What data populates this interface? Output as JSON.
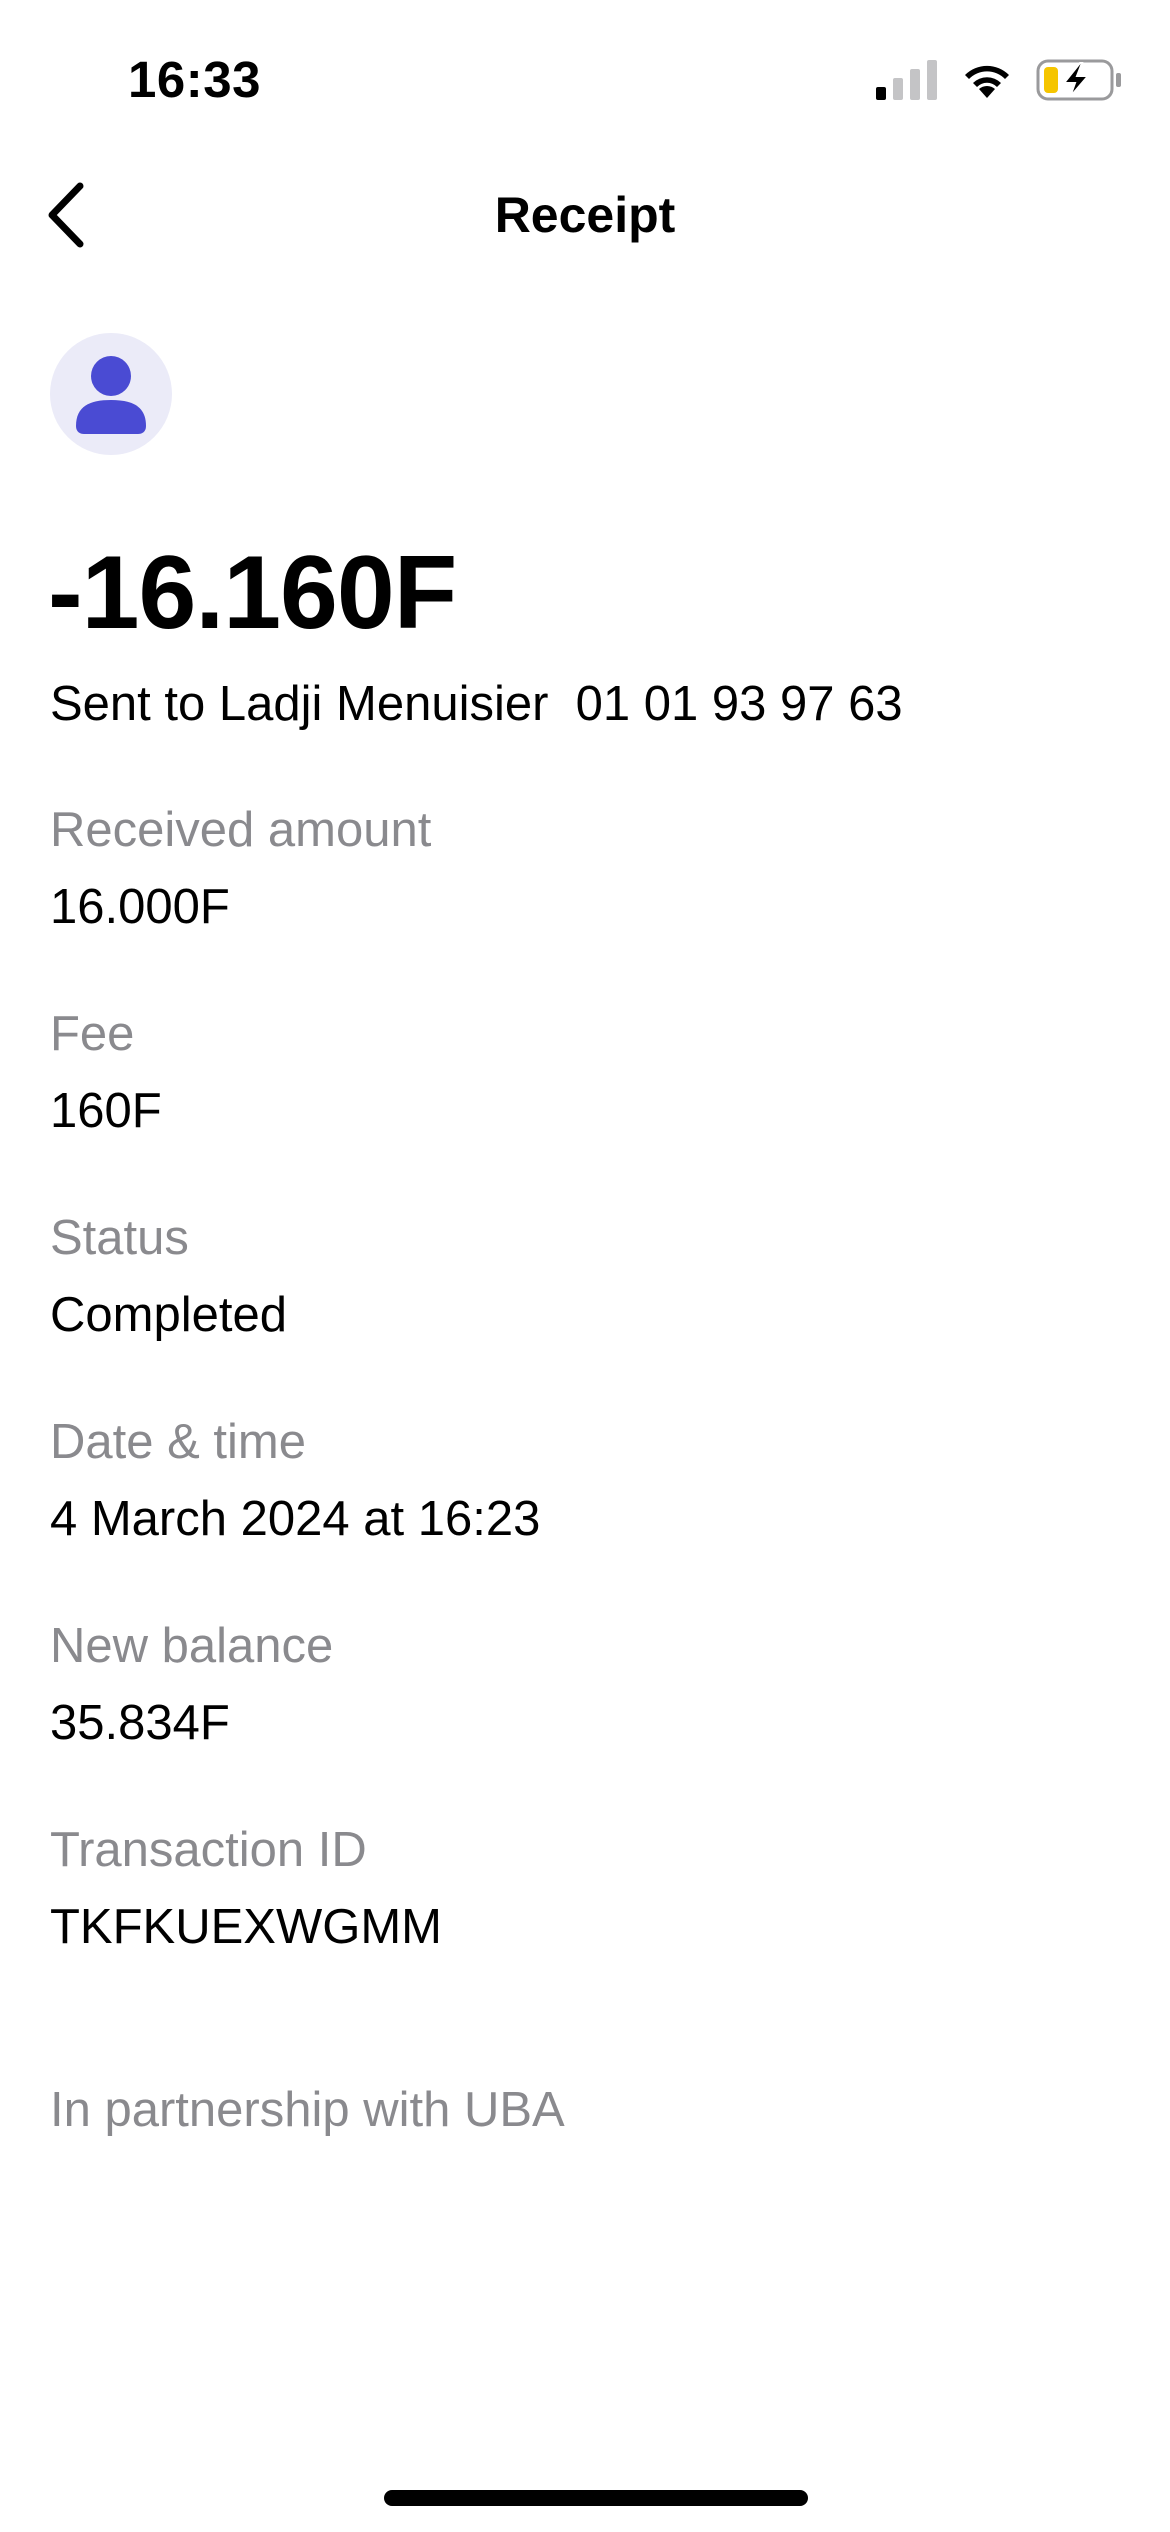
{
  "status_bar": {
    "time": "16:33",
    "icons": [
      "cellular-signal-icon",
      "wifi-icon",
      "battery-charging-icon"
    ],
    "battery_color": "#f5c500"
  },
  "nav": {
    "title": "Receipt",
    "back_icon": "chevron-left-icon"
  },
  "avatar": {
    "icon": "person-icon",
    "icon_color": "#4a4bd3",
    "bg_color": "#ebebf8"
  },
  "transaction": {
    "amount": "-16.160F",
    "recipient_line": "Sent to Ladji Menuisier  01 01 93 97 63"
  },
  "details": [
    {
      "label": "Received amount",
      "value": "16.000F"
    },
    {
      "label": "Fee",
      "value": "160F"
    },
    {
      "label": "Status",
      "value": "Completed"
    },
    {
      "label": "Date & time",
      "value": "4 March 2024 at 16:23"
    },
    {
      "label": "New balance",
      "value": "35.834F"
    },
    {
      "label": "Transaction ID",
      "value": "TKFKUEXWGMM"
    }
  ],
  "footer": {
    "partnership": "In partnership with UBA"
  }
}
